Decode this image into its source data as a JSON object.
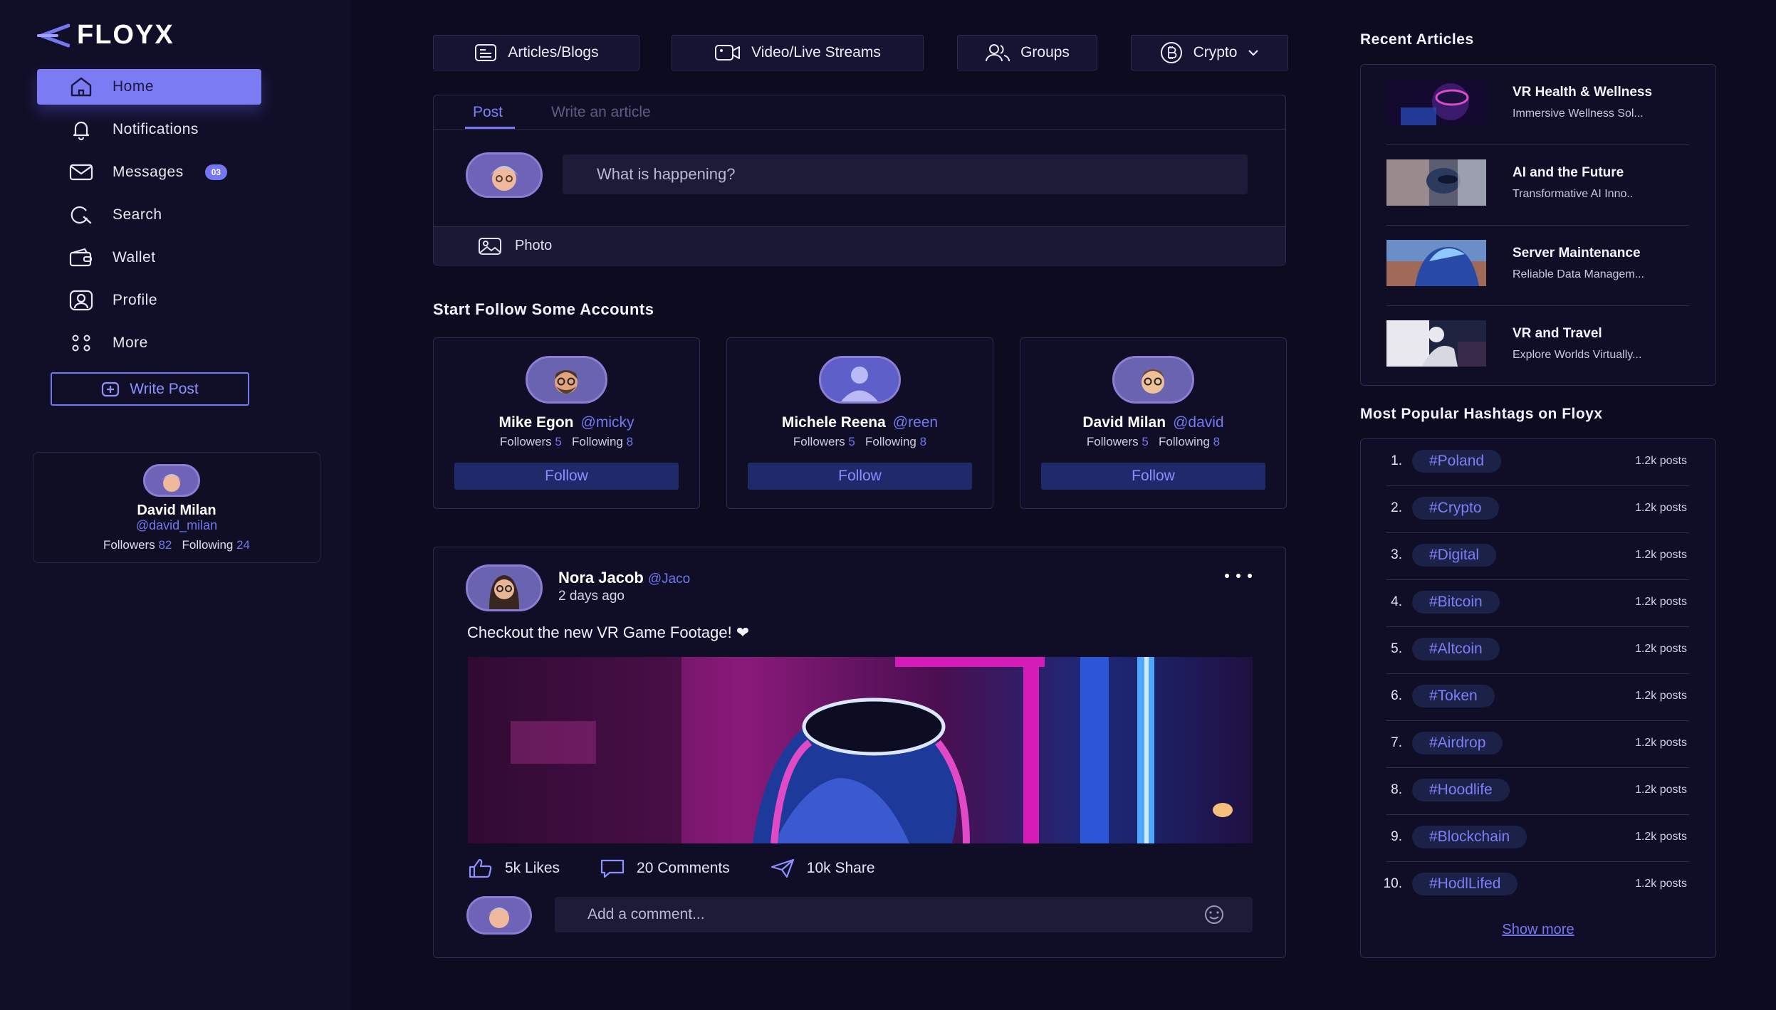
{
  "app": {
    "name": "FLOYX",
    "accent_color": "#7577f1",
    "background_color": "#0d0b20"
  },
  "sidebar": {
    "items": [
      {
        "label": "Home",
        "icon": "home-icon",
        "active": true
      },
      {
        "label": "Notifications",
        "icon": "bell-icon"
      },
      {
        "label": "Messages",
        "icon": "mail-icon",
        "badge": "03"
      },
      {
        "label": "Search",
        "icon": "search-icon"
      },
      {
        "label": "Wallet",
        "icon": "wallet-icon"
      },
      {
        "label": "Profile",
        "icon": "profile-icon"
      },
      {
        "label": "More",
        "icon": "grid-dots-icon"
      }
    ],
    "write_post_label": "Write Post",
    "profile": {
      "name": "David Milan",
      "handle": "@david_milan",
      "followers_label": "Followers",
      "followers": "82",
      "following_label": "Following",
      "following": "24"
    }
  },
  "filters": [
    {
      "label": "Articles/Blogs",
      "icon": "document-icon"
    },
    {
      "label": "Video/Live Streams",
      "icon": "video-icon"
    },
    {
      "label": "Groups",
      "icon": "users-icon"
    },
    {
      "label": "Crypto",
      "icon": "bitcoin-icon",
      "dropdown": true
    }
  ],
  "composer": {
    "tabs": [
      "Post",
      "Write an article"
    ],
    "active_tab": "Post",
    "placeholder": "What is happening?",
    "photo_label": "Photo"
  },
  "suggestions": {
    "title": "Start Follow Some Accounts",
    "accounts": [
      {
        "name": "Mike Egon",
        "handle": "@micky",
        "followers": "5",
        "following": "8"
      },
      {
        "name": "Michele Reena",
        "handle": "@reen",
        "followers": "5",
        "following": "8"
      },
      {
        "name": "David Milan",
        "handle": "@david",
        "followers": "5",
        "following": "8"
      }
    ],
    "followers_label": "Followers",
    "following_label": "Following",
    "follow_label": "Follow"
  },
  "post": {
    "author": "Nora Jacob",
    "handle": "@Jaco",
    "time": "2 days ago",
    "text": "Checkout the new VR Game Footage! ❤",
    "likes": "5k Likes",
    "comments": "20 Comments",
    "shares": "10k Share",
    "comment_placeholder": "Add a comment..."
  },
  "recent_articles": {
    "title": "Recent Articles",
    "items": [
      {
        "title": "VR Health & Wellness",
        "subtitle": "Immersive Wellness Sol..."
      },
      {
        "title": "AI and the Future",
        "subtitle": "Transformative AI Inno.."
      },
      {
        "title": "Server Maintenance",
        "subtitle": "Reliable Data Managem..."
      },
      {
        "title": "VR and Travel",
        "subtitle": "Explore Worlds Virtually..."
      }
    ]
  },
  "hashtags": {
    "title": "Most Popular Hashtags on Floyx",
    "items": [
      {
        "rank": "1.",
        "tag": "#Poland",
        "count": "1.2k posts"
      },
      {
        "rank": "2.",
        "tag": "#Crypto",
        "count": "1.2k posts"
      },
      {
        "rank": "3.",
        "tag": "#Digital",
        "count": "1.2k posts"
      },
      {
        "rank": "4.",
        "tag": "#Bitcoin",
        "count": "1.2k posts"
      },
      {
        "rank": "5.",
        "tag": "#Altcoin",
        "count": "1.2k posts"
      },
      {
        "rank": "6.",
        "tag": "#Token",
        "count": "1.2k posts"
      },
      {
        "rank": "7.",
        "tag": "#Airdrop",
        "count": "1.2k posts"
      },
      {
        "rank": "8.",
        "tag": "#Hoodlife",
        "count": "1.2k posts"
      },
      {
        "rank": "9.",
        "tag": "#Blockchain",
        "count": "1.2k posts"
      },
      {
        "rank": "10.",
        "tag": "#HodlLifed",
        "count": "1.2k posts"
      }
    ],
    "show_more_label": "Show more"
  }
}
